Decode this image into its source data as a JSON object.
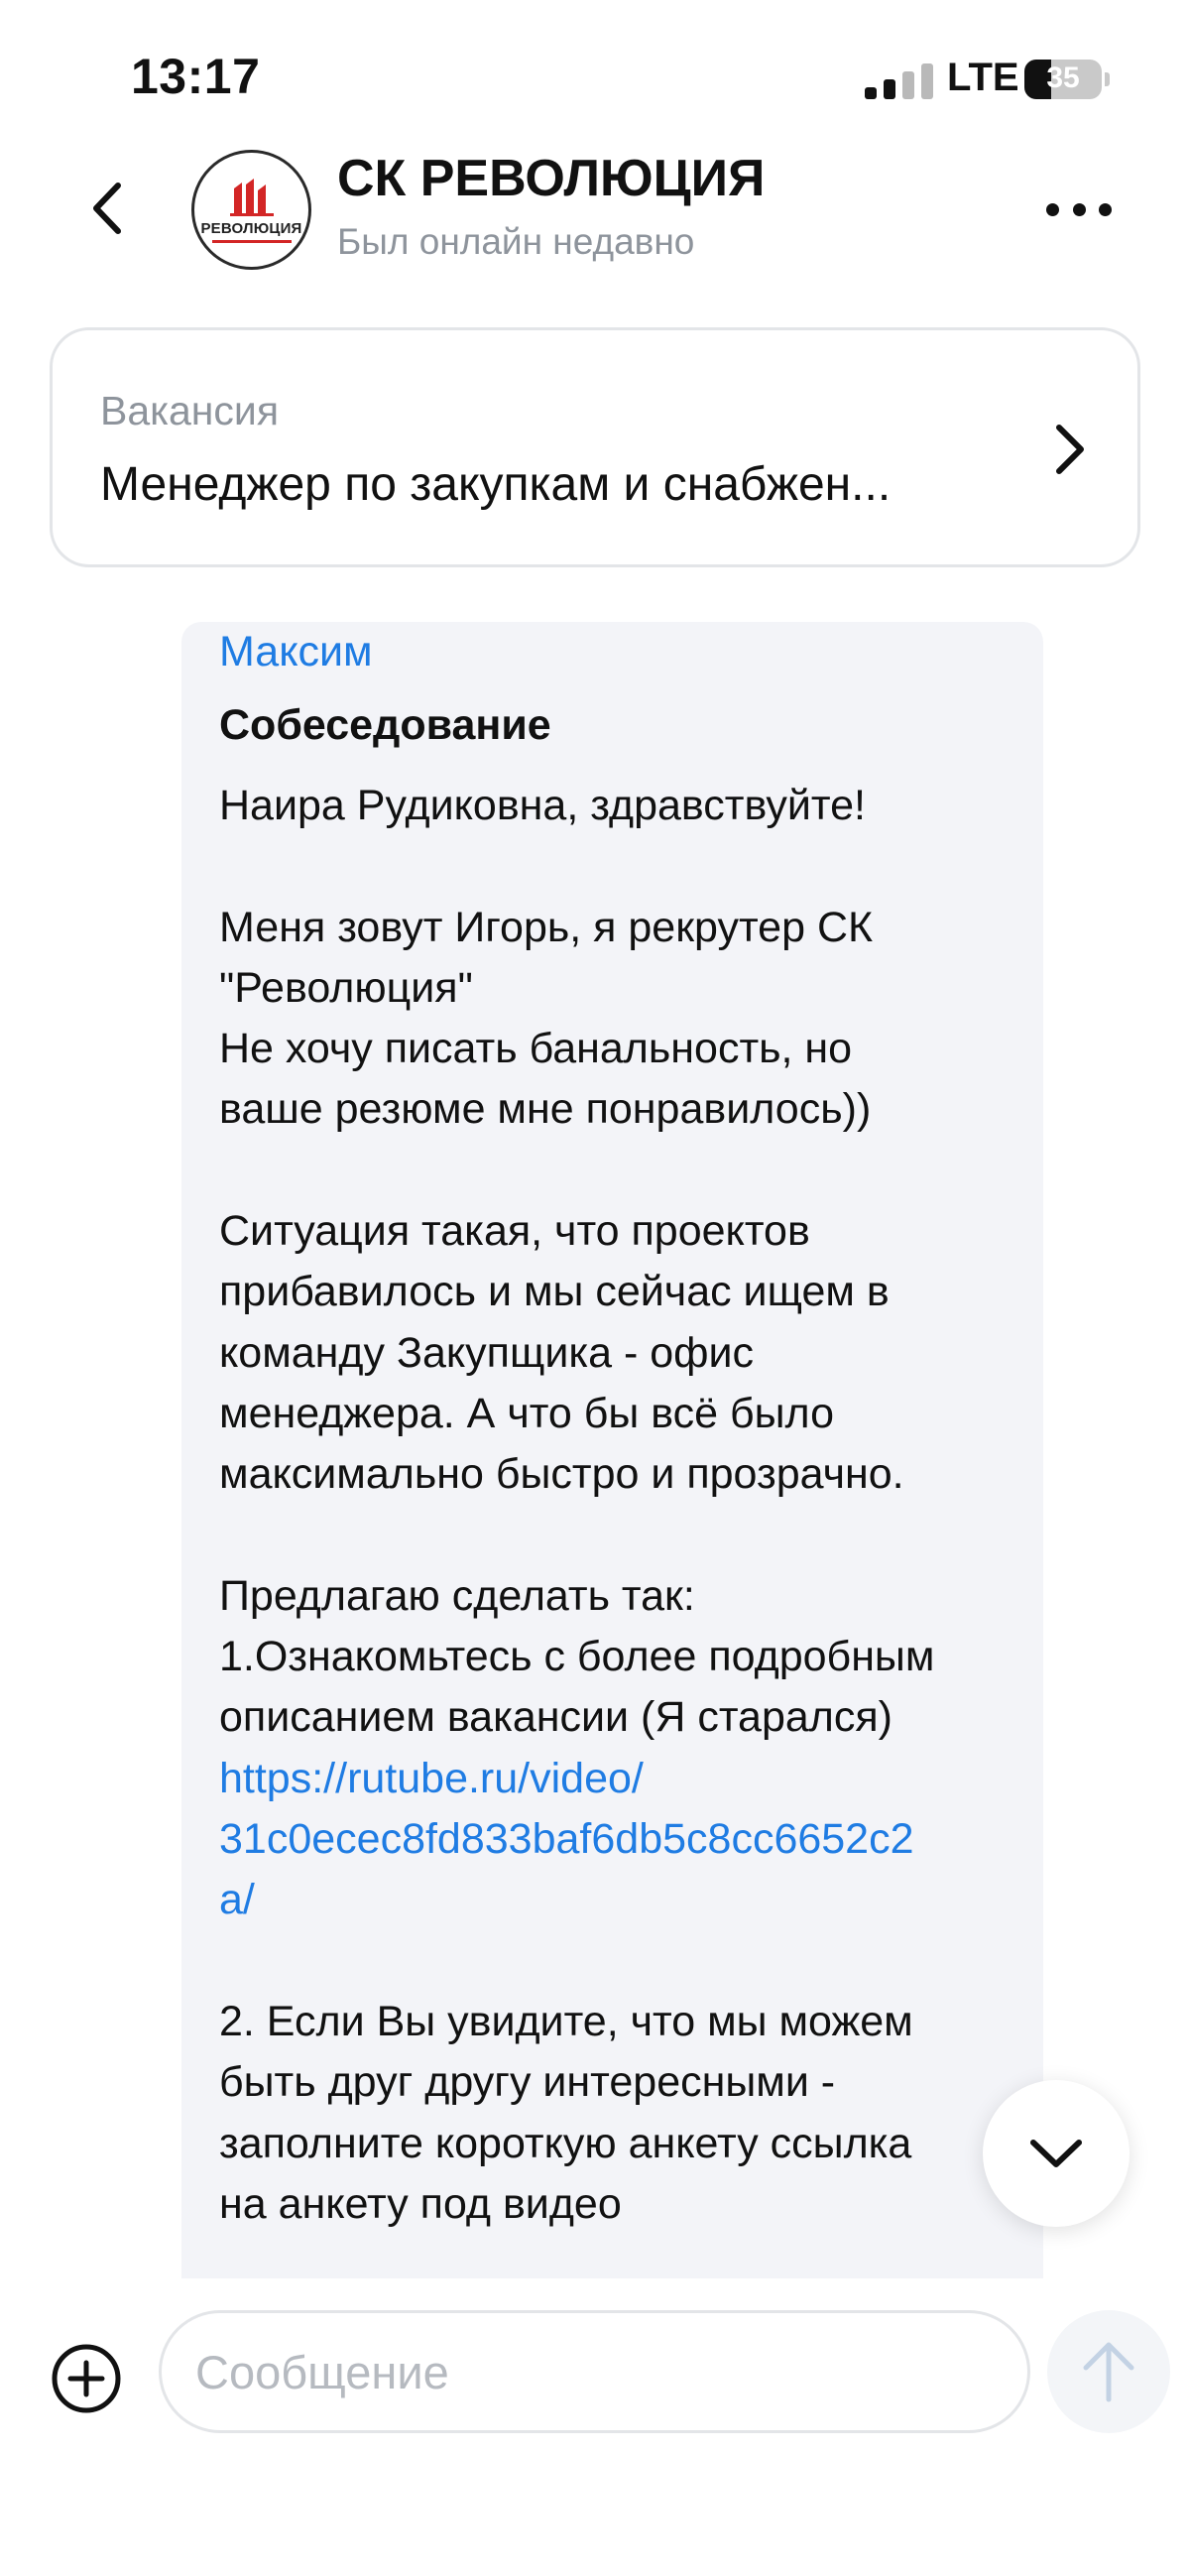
{
  "status_bar": {
    "time": "13:17",
    "network": "LTE",
    "battery": "35",
    "battery_level": 0.35
  },
  "header": {
    "title": "СК РЕВОЛЮЦИЯ",
    "subtitle": "Был онлайн недавно",
    "avatar_logo_text": "РЕВОЛЮЦИЯ",
    "icons": {
      "back": "chevron-left-icon",
      "more": "more-dots-icon"
    }
  },
  "vacancy": {
    "label": "Вакансия",
    "title": "Менеджер по закупкам и снабжен...",
    "icon": "chevron-right-icon"
  },
  "message": {
    "sender": "Максим",
    "subject": "Собеседование",
    "lines": [
      "Наира Рудиковна, здравствуйте!",
      "",
      "Меня зовут Игорь, я рекрутер СК",
      "\"Революция\"",
      "Не хочу писать банальность, но",
      "ваше резюме мне понравилось))",
      "",
      "Ситуация такая, что проектов",
      "прибавилось и мы сейчас ищем в",
      "команду Закупщика - офис",
      "менеджера. А что бы всё было",
      "максимально быстро и прозрачно.",
      "",
      "Предлагаю сделать так:",
      "1.Ознакомьтесь с более подробным",
      "описанием вакансии (Я старался)"
    ],
    "link_lines": [
      "https://rutube.ru/video/",
      "31c0ecec8fd833baf6db5c8cc6652c2",
      "a/"
    ],
    "lines_after_link": [
      "",
      "2. Если Вы увидите, что мы можем",
      "быть друг другу интересными -",
      "заполните короткую анкету ссылка",
      "на анкету под видео"
    ]
  },
  "composer": {
    "placeholder": "Сообщение",
    "value": "",
    "icons": {
      "attach": "plus-circle-icon",
      "send": "arrow-up-icon",
      "scroll": "chevron-down-icon"
    }
  },
  "colors": {
    "accent": "#1f7ce3",
    "bubble_background": "#f3f4f8",
    "secondary_text": "#8e949c",
    "border": "#e3e5e8"
  }
}
